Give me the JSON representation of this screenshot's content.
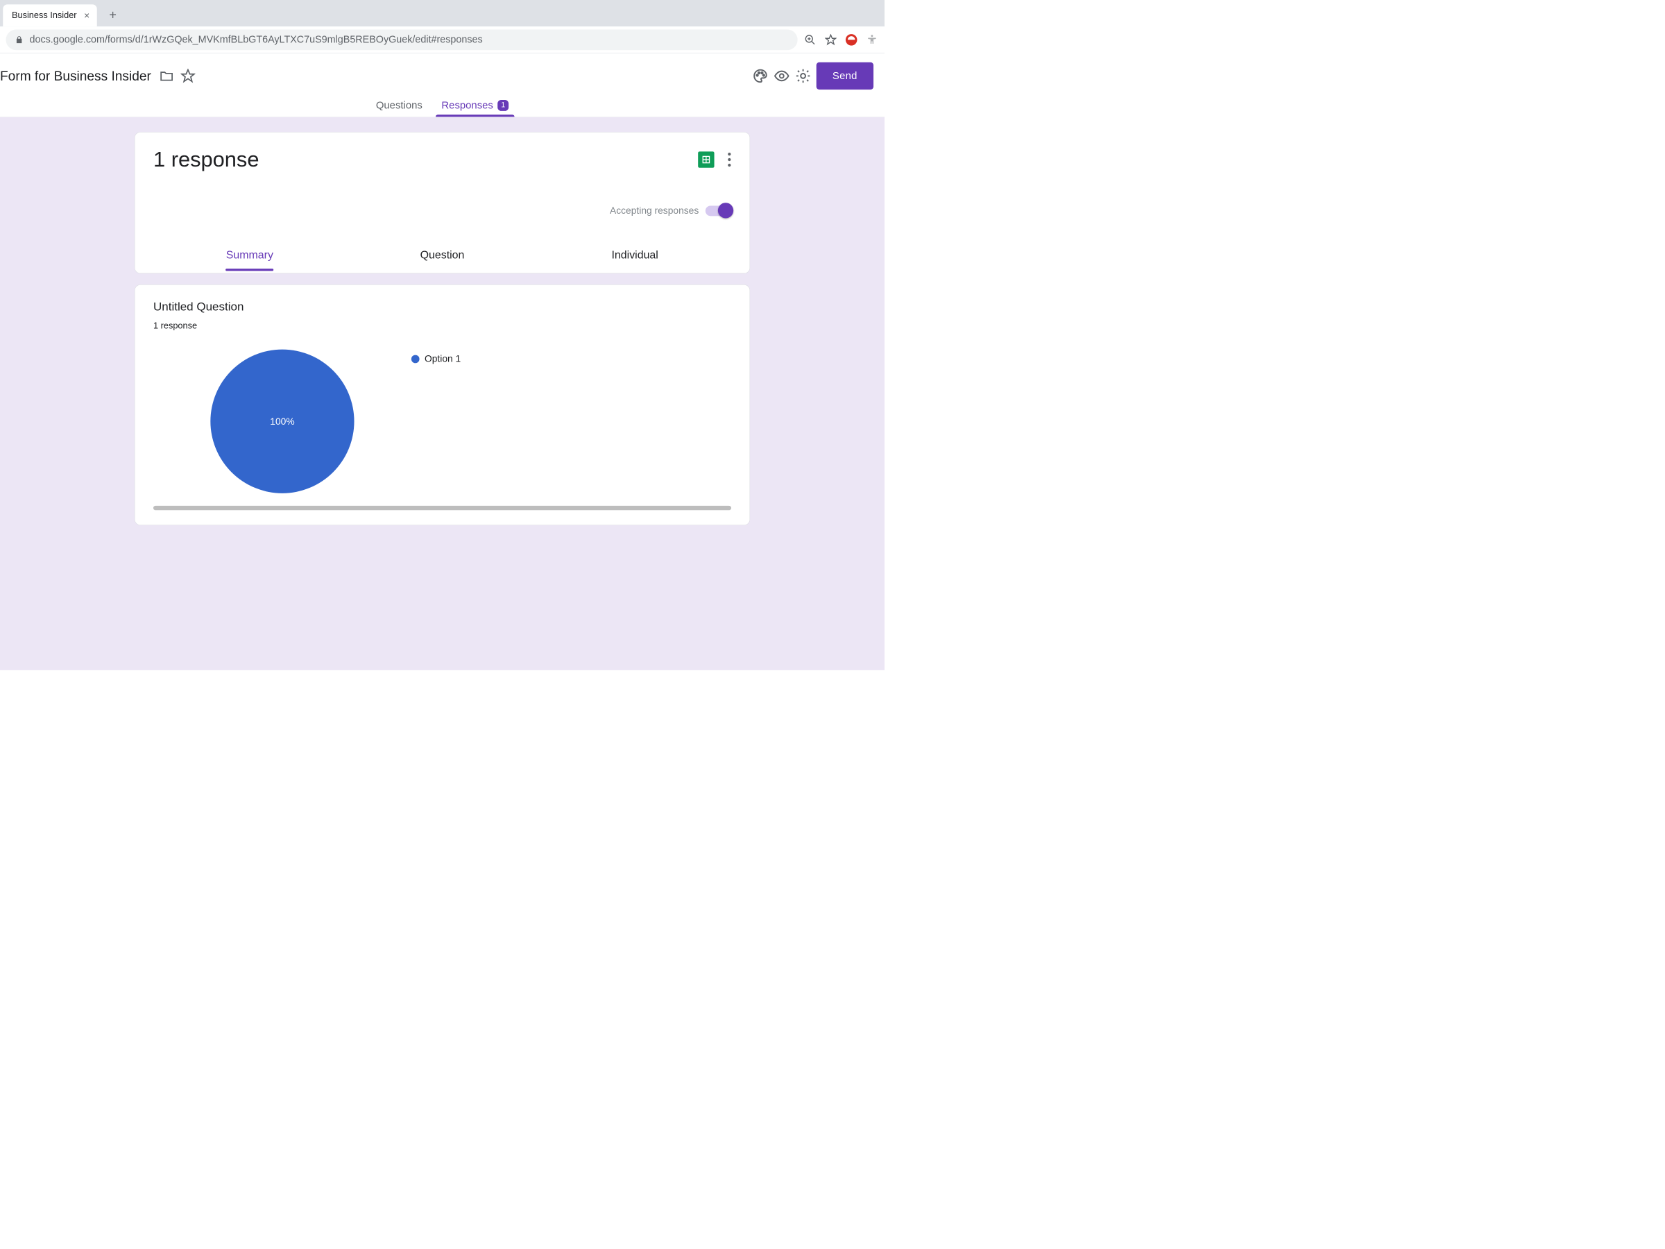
{
  "browser": {
    "tab_title": "Business Insider",
    "url_display": "docs.google.com/forms/d/1rWzGQek_MVKmfBLbGT6AyLTXC7uS9mlgB5REBOyGuek/edit#responses"
  },
  "header": {
    "form_title": "Form for Business Insider",
    "send_label": "Send"
  },
  "main_tabs": {
    "questions": "Questions",
    "responses": "Responses",
    "badge_count": "1"
  },
  "responses_card": {
    "title": "1 response",
    "accepting_label": "Accepting responses",
    "sub_tabs": {
      "summary": "Summary",
      "question": "Question",
      "individual": "Individual"
    }
  },
  "question_card": {
    "title": "Untitled Question",
    "subtitle": "1 response",
    "center_label": "100%"
  },
  "chart_data": {
    "type": "pie",
    "title": "Untitled Question",
    "categories": [
      "Option 1"
    ],
    "values": [
      1
    ],
    "series": [
      {
        "name": "Option 1",
        "color": "#3366cc"
      }
    ]
  }
}
